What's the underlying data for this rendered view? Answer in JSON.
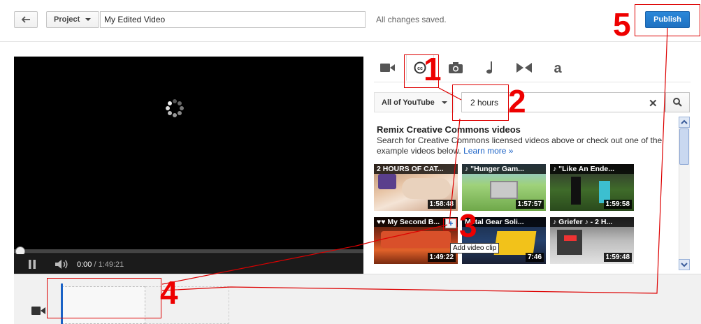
{
  "header": {
    "back_label": "",
    "project_label": "Project",
    "video_title": "My Edited Video",
    "save_status": "All changes saved.",
    "publish_label": "Publish"
  },
  "player": {
    "current_time": "0:00",
    "duration": "/ 1:49:21"
  },
  "panel": {
    "tabs": [
      "video-camera-icon",
      "cc-icon",
      "camera-icon",
      "music-note-icon",
      "transitions-icon",
      "text-icon"
    ],
    "source_label": "All of YouTube",
    "search_value": "2 hours",
    "heading": "Remix Creative Commons videos",
    "description": "Search for Creative Commons licensed videos above or check out one of the example videos below.",
    "learn_more": "Learn more »",
    "tooltip": "Add video clip",
    "videos": [
      {
        "title": "2 HOURS OF CAT...",
        "duration": "1:58:48"
      },
      {
        "title": "♪ \"Hunger Gam...",
        "duration": "1:57:57"
      },
      {
        "title": "♪ \"Like An Ende...",
        "duration": "1:59:58"
      },
      {
        "title": "♥♥ My Second B...",
        "duration": "1:49:22"
      },
      {
        "title": "Metal Gear Soli...",
        "duration": "7:46"
      },
      {
        "title": "♪ Griefer ♪ - 2 H...",
        "duration": "1:59:48"
      }
    ]
  },
  "annotations": [
    "1",
    "2",
    "3",
    "4",
    "5"
  ],
  "colors": {
    "accent": "#1f71c1",
    "annotation": "#e00000"
  }
}
